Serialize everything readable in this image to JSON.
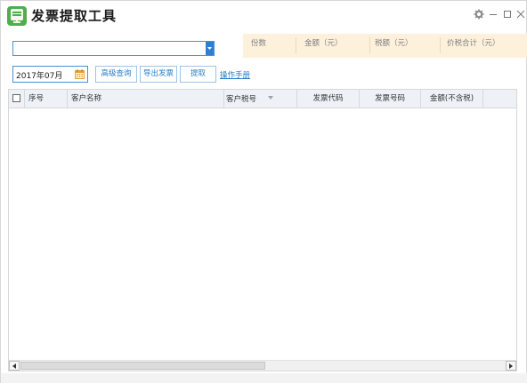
{
  "app": {
    "title": "发票提取工具"
  },
  "summary": {
    "count_label": "份数",
    "amount_label": "金额（元）",
    "tax_label": "税额（元）",
    "total_label": "价税合计（元）"
  },
  "controls": {
    "dropdown_value": "",
    "date_value": "2017年07月",
    "advanced_query": "高级查询",
    "export_invoice": "导出发票",
    "extract": "提取",
    "manual_link": "操作手册"
  },
  "table": {
    "columns": [
      "序号",
      "客户名称",
      "客户税号",
      "发票代码",
      "发票号码",
      "金额(不含税)"
    ],
    "rows": []
  },
  "colors": {
    "accent": "#2f7fd1",
    "summary_bg": "#fdf1dc",
    "header_bg": "#eef2f7",
    "logo_green": "#4cae4f"
  },
  "icons": [
    "app-logo-icon",
    "gear-icon",
    "minimize-icon",
    "maximize-icon",
    "close-icon",
    "calendar-icon",
    "chevron-down-icon",
    "sort-icon",
    "scroll-left-icon",
    "scroll-right-icon"
  ]
}
